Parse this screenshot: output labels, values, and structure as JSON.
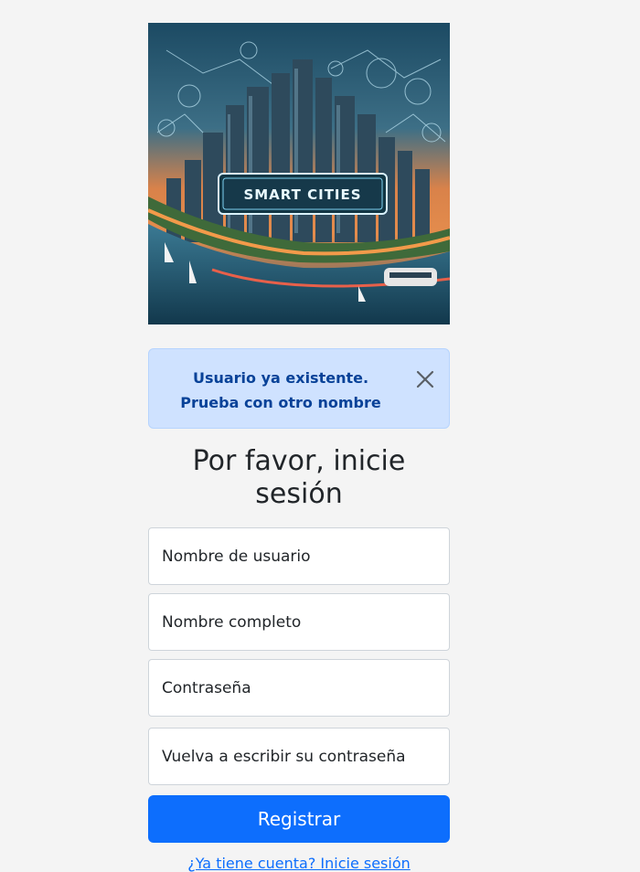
{
  "hero": {
    "title": "SMART CITIES"
  },
  "alert": {
    "message": "Usuario ya existente. Prueba con otro nombre"
  },
  "heading": "Por favor, inicie sesión",
  "fields": {
    "username_placeholder": "Nombre de usuario",
    "fullname_placeholder": "Nombre completo",
    "password_placeholder": "Contraseña",
    "password2_placeholder": "Vuelva a escribir su contraseña"
  },
  "register_button": "Registrar",
  "login_link": "¿Ya tiene cuenta? Inicie sesión",
  "colors": {
    "primary": "#0d6efd",
    "alert_bg": "#cfe2ff",
    "alert_text": "#084298",
    "page_bg": "#f4f4f4"
  }
}
